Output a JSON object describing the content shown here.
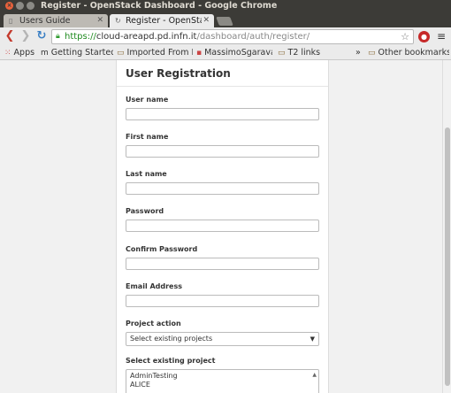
{
  "window": {
    "title": "Register - OpenStack Dashboard - Google Chrome"
  },
  "tabs": [
    {
      "label": "Users Guide"
    },
    {
      "label": "Register - OpenStack Dashboard"
    }
  ],
  "toolbar": {
    "url_scheme": "https://",
    "url_host": "cloud-areapd.pd.infn.it",
    "url_path": "/dashboard/auth/register/"
  },
  "bookmarks": {
    "apps": "Apps",
    "items": [
      {
        "label": "Getting Started"
      },
      {
        "label": "Imported From Firefox"
      },
      {
        "label": "MassimoSgaravatto"
      },
      {
        "label": "T2 links"
      }
    ],
    "overflow": "»",
    "other": "Other bookmarks"
  },
  "form": {
    "title": "User Registration",
    "fields": [
      {
        "label": "User name"
      },
      {
        "label": "First name"
      },
      {
        "label": "Last name"
      },
      {
        "label": "Password"
      },
      {
        "label": "Confirm Password"
      },
      {
        "label": "Email Address"
      }
    ],
    "project_action": {
      "label": "Project action",
      "selected": "Select existing projects"
    },
    "existing_project": {
      "label": "Select existing project",
      "options": [
        "AdminTesting",
        "ALICE"
      ]
    }
  }
}
